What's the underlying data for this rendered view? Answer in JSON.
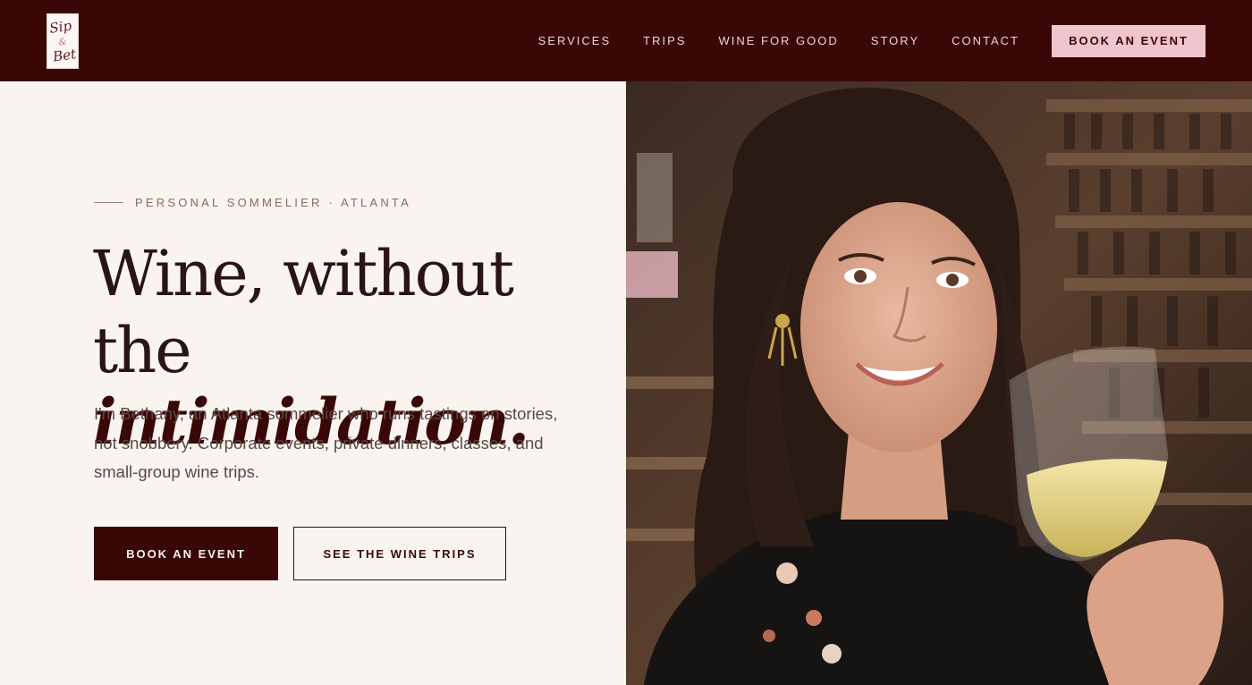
{
  "header": {
    "logo": {
      "alt": "Sip & Bet logo"
    },
    "nav": [
      {
        "label": "SERVICES"
      },
      {
        "label": "TRIPS"
      },
      {
        "label": "WINE FOR GOOD"
      },
      {
        "label": "STORY"
      },
      {
        "label": "CONTACT"
      }
    ],
    "cta_label": "BOOK AN EVENT"
  },
  "hero": {
    "eyebrow": "PERSONAL SOMMELIER · ATLANTA",
    "headline_line1": "Wine, without the",
    "headline_line2": "intimidation.",
    "intro": "I'm Bethany, an Atlanta sommelier who runs tastings on stories, not snobbery. Corporate events, private dinners, classes, and small-group wine trips.",
    "primary_button": "BOOK AN EVENT",
    "secondary_button": "SEE THE WINE TRIPS"
  },
  "colors": {
    "header_bg": "#3a0707",
    "cta_pink": "#f0c6ce",
    "page_bg": "#f9f4ef",
    "text_dark": "#2a1414"
  }
}
